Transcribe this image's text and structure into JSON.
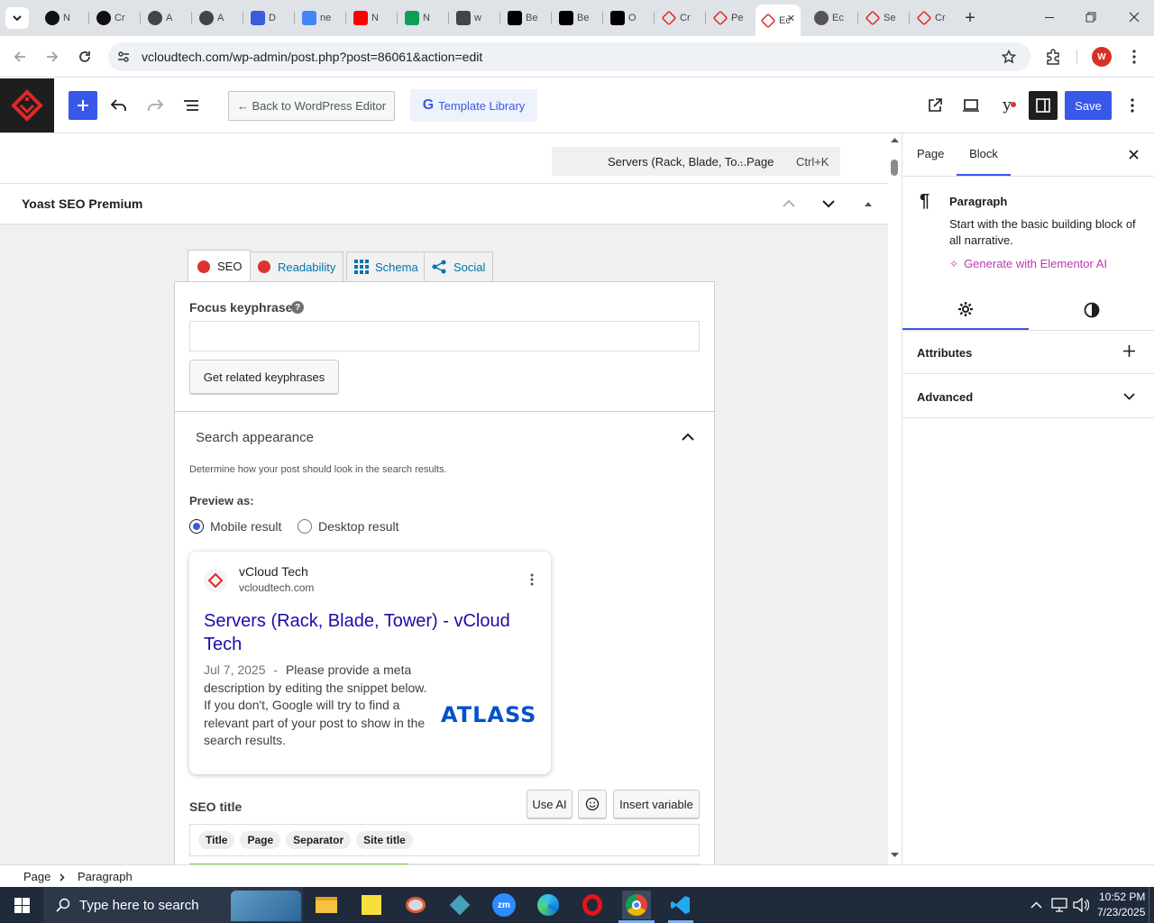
{
  "browser": {
    "tabs": [
      {
        "label": "N",
        "icon": "openai-icon",
        "color": "#111111"
      },
      {
        "label": "Cr",
        "icon": "openai-icon",
        "color": "#111111"
      },
      {
        "label": "A",
        "icon": "openai-icon",
        "color": "#444444"
      },
      {
        "label": "A",
        "icon": "openai-icon",
        "color": "#444444"
      },
      {
        "label": "D",
        "icon": "wordtune-icon",
        "color": "#3b5bdb"
      },
      {
        "label": "ne",
        "icon": "google-icon",
        "color": "#4285f4"
      },
      {
        "label": "N",
        "icon": "youtube-icon",
        "color": "#ff0000"
      },
      {
        "label": "N",
        "icon": "w-icon",
        "color": "#0f9d58"
      },
      {
        "label": "w",
        "icon": "linkedin-icon",
        "color": "#444444"
      },
      {
        "label": "Be",
        "icon": "x-icon",
        "color": "#000000"
      },
      {
        "label": "Be",
        "icon": "x-icon",
        "color": "#000000"
      },
      {
        "label": "O",
        "icon": "asterisk-icon",
        "color": "#000000"
      },
      {
        "label": "Cr",
        "icon": "vcloud-icon",
        "color": "#e02828"
      },
      {
        "label": "Pe",
        "icon": "vcloud-icon",
        "color": "#e02828"
      },
      {
        "label": "Ec",
        "icon": "vcloud-icon",
        "color": "#e02828"
      },
      {
        "label": "Ec",
        "icon": "globe-icon",
        "color": "#555555"
      },
      {
        "label": "Se",
        "icon": "vcloud-icon",
        "color": "#e02828"
      },
      {
        "label": "Cr",
        "icon": "vcloud-icon",
        "color": "#e02828"
      }
    ],
    "active_tab_index": 14,
    "url": "vcloudtech.com/wp-admin/post.php?post=86061&action=edit",
    "profile_initial": "W"
  },
  "wp_header": {
    "back_button": "← Back to WordPress Editor",
    "template_library": "Template Library",
    "save": "Save"
  },
  "command_bar": {
    "title": "Servers (Rack, Blade, To...",
    "type": "· Page",
    "shortcut": "Ctrl+K"
  },
  "yoast": {
    "panel_title": "Yoast SEO Premium",
    "tabs": [
      "SEO",
      "Readability",
      "Schema",
      "Social"
    ],
    "focus_keyphrase_label": "Focus keyphrase",
    "focus_keyphrase_value": "",
    "related_button": "Get related keyphrases",
    "search_appearance": "Search appearance",
    "search_appearance_desc": "Determine how your post should look in the search results.",
    "preview_as": "Preview as:",
    "preview_options": [
      "Mobile result",
      "Desktop result"
    ],
    "preview_selected": "Mobile result",
    "snippet": {
      "site_name": "vCloud Tech",
      "site_url": "vcloudtech.com",
      "title": "Servers (Rack, Blade, Tower) - vCloud Tech",
      "date": "Jul 7, 2025",
      "separator": "-",
      "description": "Please provide a meta description by editing the snippet below. If you don't, Google will try to find a relevant part of your post to show in the search results.",
      "image_text": "ATLASSI"
    },
    "seo_title_label": "SEO title",
    "use_ai": "Use AI",
    "insert_variable": "Insert variable",
    "seo_title_pills": [
      "Title",
      "Page",
      "Separator",
      "Site title"
    ]
  },
  "sidebar": {
    "tabs": [
      "Page",
      "Block"
    ],
    "active_tab": "Block",
    "block_name": "Paragraph",
    "block_desc": "Start with the basic building block of all narrative.",
    "ai_link": "Generate with Elementor AI",
    "sections": [
      "Attributes",
      "Advanced"
    ]
  },
  "breadcrumb": [
    "Page",
    "Paragraph"
  ],
  "taskbar": {
    "search_placeholder": "Type here to search",
    "time": "10:52 PM",
    "date": "7/23/2025"
  },
  "colors": {
    "wp_blue": "#3858e9",
    "yoast_link": "#0073aa",
    "google_title": "#1a0dab",
    "error_red": "#dc3232",
    "elementor_pink": "#c036b5"
  }
}
